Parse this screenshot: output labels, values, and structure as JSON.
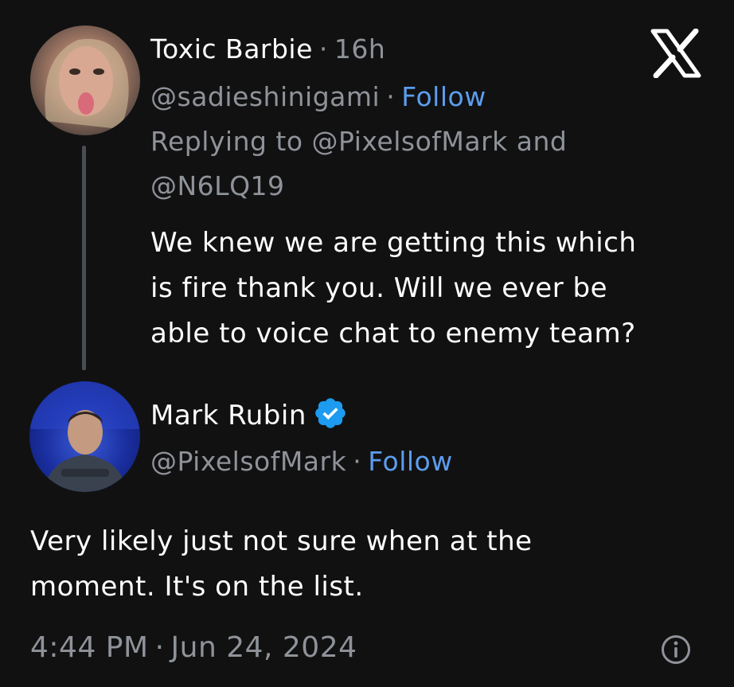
{
  "close_icon": "x-logo-icon",
  "reply_tweet": {
    "display_name": "Toxic Barbie",
    "separator": "·",
    "time": "16h",
    "handle": "@sadieshinigami",
    "follow_label": "Follow",
    "replying_prefix": "Replying to",
    "replying_user1": "@PixelsofMark",
    "replying_and": "and",
    "replying_user2": "@N6LQ19",
    "body_lines": [
      "We knew we are getting this which",
      "is fire thank you. Will we ever be",
      "able to voice chat to enemy team?"
    ]
  },
  "main_tweet": {
    "display_name": "Mark Rubin",
    "verified_icon": "verified-badge-icon",
    "separator": "·",
    "handle": "@PixelsofMark",
    "follow_label": "Follow",
    "body_lines": [
      "Very likely just not sure when at the",
      "moment. It's on the list."
    ],
    "time": "4:44 PM",
    "date": "Jun 24, 2024",
    "info_icon": "info-icon"
  },
  "colors": {
    "background": "#111112",
    "text": "#ffffff",
    "muted": "#8f9399",
    "link": "#5c9ded",
    "verified": "#1d9bf0",
    "thread_line": "#4a4d52"
  }
}
